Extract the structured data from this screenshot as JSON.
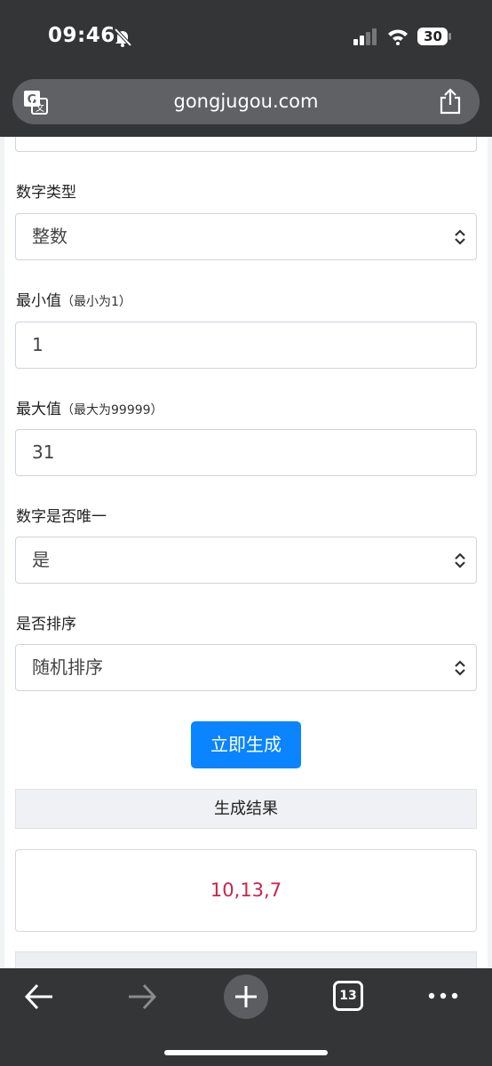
{
  "status_bar": {
    "time": "09:46",
    "battery": "30",
    "icons": [
      "bell-slash-icon",
      "signal-icon",
      "wifi-icon",
      "battery-icon"
    ]
  },
  "browser": {
    "url": "gongjugou.com",
    "icons": [
      "translate-icon",
      "share-icon"
    ]
  },
  "form": {
    "number_type": {
      "label": "数字类型",
      "value": "整数"
    },
    "min_value": {
      "label": "最小值",
      "hint": "（最小为1）",
      "value": "1"
    },
    "max_value": {
      "label": "最大值",
      "hint": "（最大为99999）",
      "value": "31"
    },
    "unique": {
      "label": "数字是否唯一",
      "value": "是"
    },
    "sort": {
      "label": "是否排序",
      "value": "随机排序"
    },
    "generate_button": "立即生成"
  },
  "result": {
    "header": "生成结果",
    "value": "10,13,7",
    "value_color": "#c7254e"
  },
  "toolbar": {
    "tab_count": "13",
    "icons": [
      "back-arrow-icon",
      "forward-arrow-icon",
      "new-tab-icon",
      "tabs-icon",
      "more-icon"
    ]
  },
  "colors": {
    "accent": "#0a84ff",
    "chrome": "#333537"
  }
}
